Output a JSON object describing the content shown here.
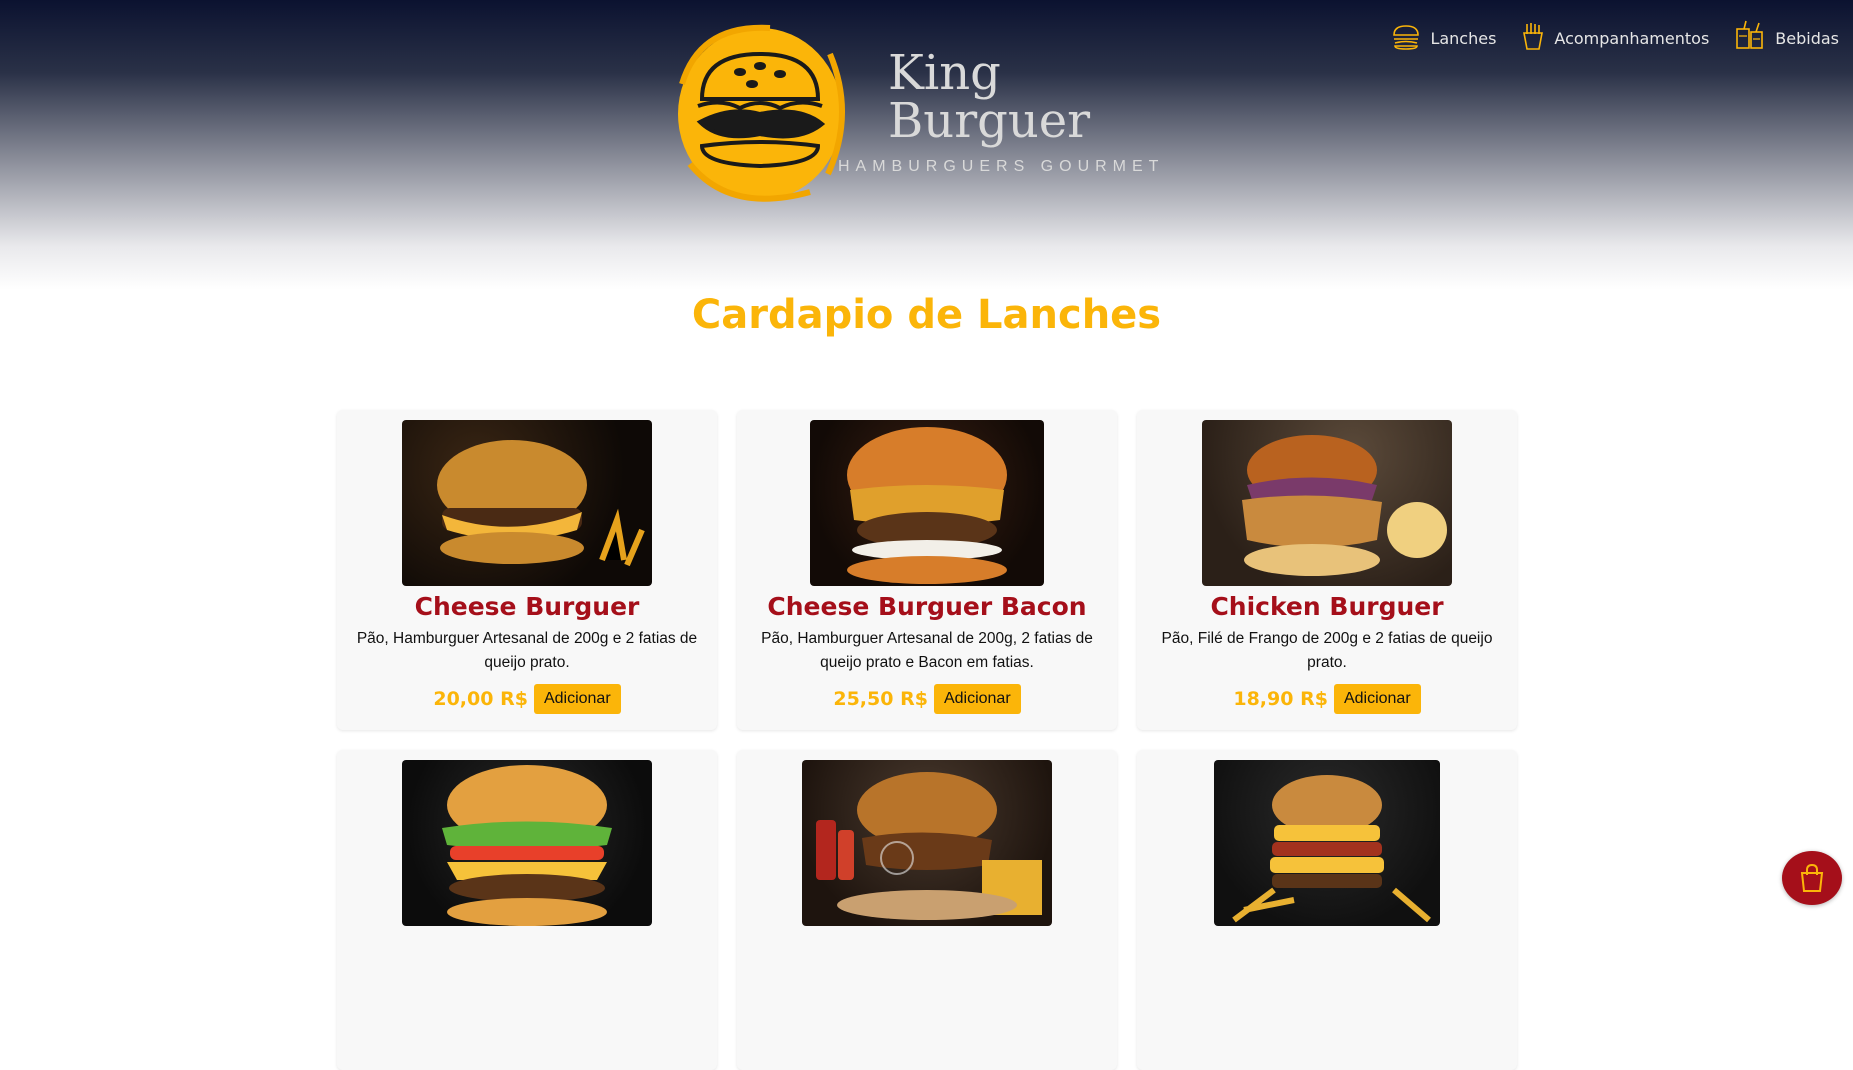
{
  "brand": {
    "name_line1": "King",
    "name_line2": "Burguer",
    "tagline": "HAMBURGUERS GOURMET"
  },
  "nav": [
    {
      "label": "Lanches",
      "icon": "burger-icon"
    },
    {
      "label": "Acompanhamentos",
      "icon": "fries-icon"
    },
    {
      "label": "Bebidas",
      "icon": "drinks-icon"
    }
  ],
  "page_title": "Cardapio de Lanches",
  "add_label": "Adicionar",
  "products": [
    {
      "name": "Cheese Burguer",
      "desc": "Pão, Hamburguer Artesanal de 200g e 2 fatias de queijo prato.",
      "price": "20,00 R$"
    },
    {
      "name": "Cheese Burguer Bacon",
      "desc": "Pão, Hamburguer Artesanal de 200g, 2 fatias de queijo prato e Bacon em fatias.",
      "price": "25,50 R$"
    },
    {
      "name": "Chicken Burguer",
      "desc": "Pão, Filé de Frango de 200g e 2 fatias de queijo prato.",
      "price": "18,90 R$"
    }
  ],
  "colors": {
    "accent": "#fbb509",
    "brand_red": "#a50f1a",
    "header_dark": "#0b1230"
  },
  "cart_icon": "shopping-bag-icon"
}
